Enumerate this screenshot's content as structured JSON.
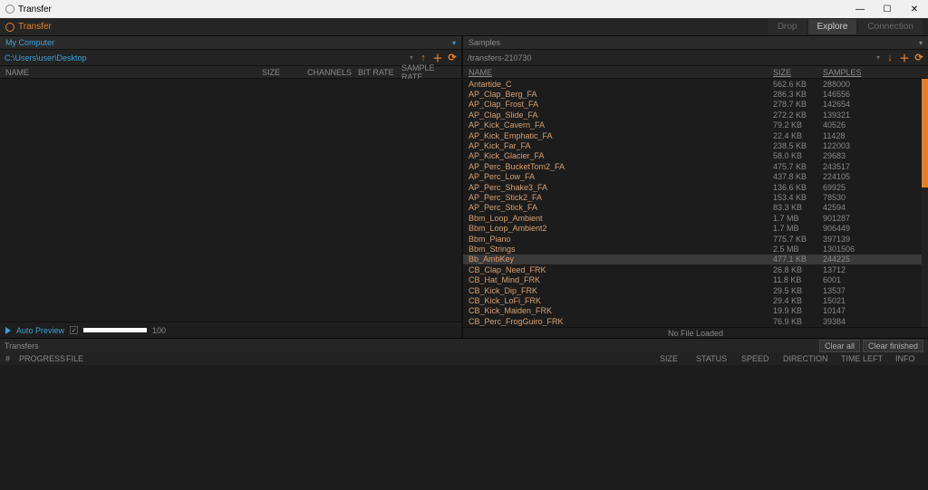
{
  "titlebar": {
    "title": "Transfer"
  },
  "apphdr": {
    "brand": "Transfer",
    "tabs": {
      "drop": "Drop",
      "explore": "Explore",
      "connection": "Connection"
    }
  },
  "left_panel": {
    "title": "My Computer",
    "path": "C:\\Users\\user\\Desktop",
    "cols": {
      "name": "NAME",
      "size": "SIZE",
      "channels": "CHANNELS",
      "bitrate": "BIT RATE",
      "samplerate": "SAMPLE RATE"
    }
  },
  "right_panel": {
    "title": "Samples",
    "path": "/transfers-210730",
    "cols": {
      "name": "NAME",
      "size": "SIZE",
      "samples": "SAMPLES"
    },
    "rows": [
      {
        "name": "Antartide_C",
        "size": "562.6 KB",
        "samples": "288000"
      },
      {
        "name": "AP_Clap_Berg_FA",
        "size": "286.3 KB",
        "samples": "146556"
      },
      {
        "name": "AP_Clap_Frost_FA",
        "size": "278.7 KB",
        "samples": "142654"
      },
      {
        "name": "AP_Clap_Slide_FA",
        "size": "272.2 KB",
        "samples": "139321"
      },
      {
        "name": "AP_Kick_Cavern_FA",
        "size": "79.2 KB",
        "samples": "40526"
      },
      {
        "name": "AP_Kick_Emphatic_FA",
        "size": "22.4 KB",
        "samples": "11428"
      },
      {
        "name": "AP_Kick_Far_FA",
        "size": "238.5 KB",
        "samples": "122003"
      },
      {
        "name": "AP_Kick_Glacier_FA",
        "size": "58.0 KB",
        "samples": "29683"
      },
      {
        "name": "AP_Perc_BucketTom2_FA",
        "size": "475.7 KB",
        "samples": "243517"
      },
      {
        "name": "AP_Perc_Low_FA",
        "size": "437.8 KB",
        "samples": "224105"
      },
      {
        "name": "AP_Perc_Shake3_FA",
        "size": "136.6 KB",
        "samples": "69925"
      },
      {
        "name": "AP_Perc_Stick2_FA",
        "size": "153.4 KB",
        "samples": "78530"
      },
      {
        "name": "AP_Perc_Stick_FA",
        "size": "83.3 KB",
        "samples": "42594"
      },
      {
        "name": "Bbm_Loop_Ambient",
        "size": "1.7 MB",
        "samples": "901287"
      },
      {
        "name": "Bbm_Loop_Ambient2",
        "size": "1.7 MB",
        "samples": "906449"
      },
      {
        "name": "Bbm_Piano",
        "size": "775.7 KB",
        "samples": "397139"
      },
      {
        "name": "Bbm_Strings",
        "size": "2.5 MB",
        "samples": "1301506"
      },
      {
        "name": "Bb_AmbKey",
        "size": "477.1 KB",
        "samples": "244225"
      },
      {
        "name": "CB_Clap_Need_FRK",
        "size": "26.8 KB",
        "samples": "13712"
      },
      {
        "name": "CB_Hat_Mind_FRK",
        "size": "11.8 KB",
        "samples": "6001"
      },
      {
        "name": "CB_Kick_Dip_FRK",
        "size": "29.5 KB",
        "samples": "13537"
      },
      {
        "name": "CB_Kick_LoFi_FRK",
        "size": "29.4 KB",
        "samples": "15021"
      },
      {
        "name": "CB_Kick_Maiden_FRK",
        "size": "19.9 KB",
        "samples": "10147"
      },
      {
        "name": "CB_Perc_FrogGuiro_FRK",
        "size": "76.9 KB",
        "samples": "39384"
      }
    ],
    "selected_index": 17
  },
  "preview": {
    "label": "Auto Preview",
    "value": "100"
  },
  "no_file": "No File Loaded",
  "transfers": {
    "title": "Transfers",
    "clear_all": "Clear all",
    "clear_finished": "Clear finished",
    "cols": {
      "num": "#",
      "progress": "PROGRESS",
      "file": "FILE",
      "size": "SIZE",
      "status": "STATUS",
      "speed": "SPEED",
      "direction": "DIRECTION",
      "timeleft": "TIME LEFT",
      "info": "INFO"
    }
  }
}
